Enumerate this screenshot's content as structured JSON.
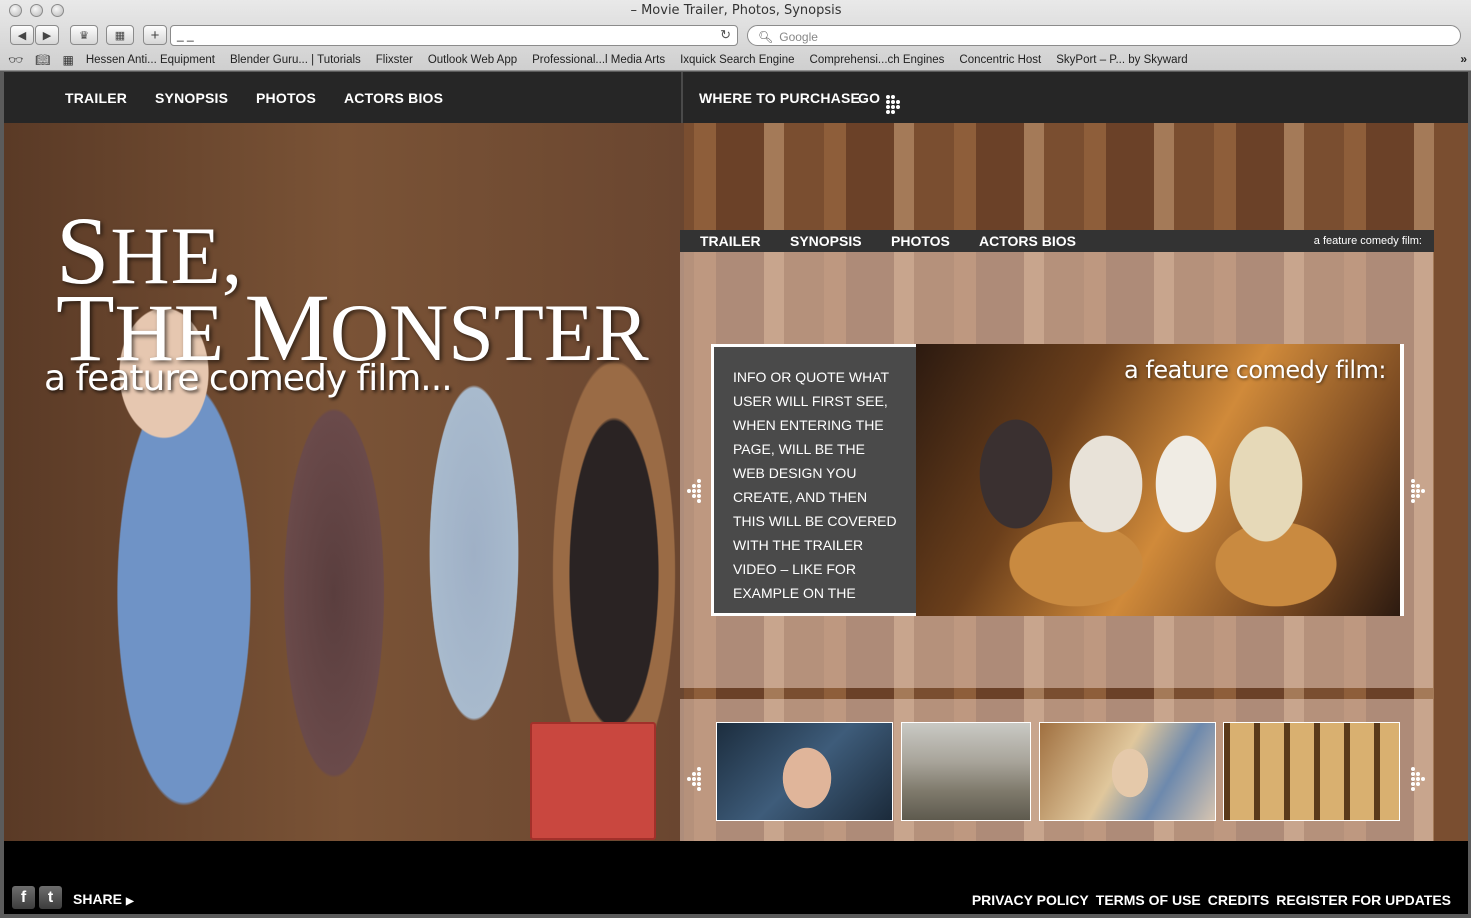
{
  "browser": {
    "window_title": "– Movie Trailer, Photos, Synopsis",
    "back_icon": "back-arrow-icon",
    "forward_icon": "forward-arrow-icon",
    "address_value": "_ _",
    "search_placeholder": "Google",
    "bookmarks": [
      "Hessen Anti... Equipment",
      "Blender Guru... | Tutorials",
      "Flixster",
      "Outlook Web App",
      "Professional...l Media Arts",
      "Ixquick Search Engine",
      "Comprehensi...ch Engines",
      "Concentric Host",
      "SkyPort – P... by Skyward"
    ]
  },
  "topnav": {
    "items": [
      "TRAILER",
      "SYNOPSIS",
      "PHOTOS",
      "ACTORS BIOS"
    ],
    "purchase_label": "WHERE TO PURCHASE",
    "go_label": "GO"
  },
  "hero": {
    "title_line1_big": "S",
    "title_line1_rest": "HE,",
    "title_line2_big": "T",
    "title_line2_rest": "HE ",
    "title_line2_big2": "M",
    "title_line2_rest2": "ONSTER",
    "subtitle": "a feature comedy film..."
  },
  "subnav": {
    "items": [
      "TRAILER",
      "SYNOPSIS",
      "PHOTOS",
      "ACTORS BIOS"
    ],
    "tag": "a feature comedy film:"
  },
  "feature": {
    "text": "INFO OR QUOTE WHAT USER WILL FIRST SEE, WHEN ENTERING THE PAGE, WILL BE THE WEB DESIGN YOU CREATE, AND THEN THIS WILL BE COVERED WITH THE TRAILER VIDEO – LIKE FOR EXAMPLE ON THE",
    "caption": "a feature comedy film:"
  },
  "footer": {
    "share_label": "SHARE",
    "links": [
      "PRIVACY POLICY",
      "TERMS OF USE",
      "CREDITS",
      "REGISTER FOR UPDATES"
    ]
  }
}
